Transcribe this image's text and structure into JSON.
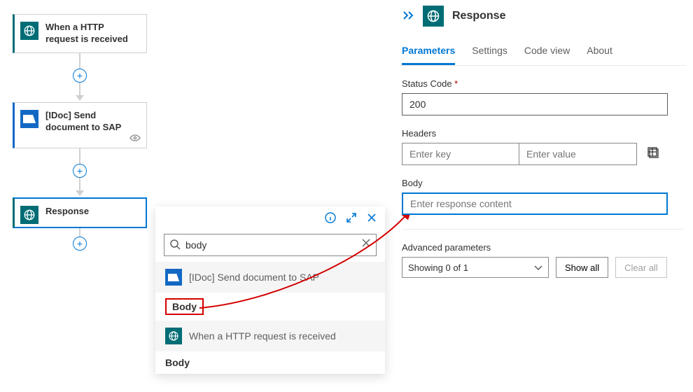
{
  "nodes": {
    "http": {
      "label": "When a HTTP request is received"
    },
    "sap": {
      "label": "[IDoc] Send document to SAP"
    },
    "resp": {
      "label": "Response"
    }
  },
  "popup": {
    "search_value": "body",
    "group1": "[IDoc] Send document to SAP",
    "item1": "Body",
    "group2": "When a HTTP request is received",
    "item2": "Body"
  },
  "panel": {
    "title": "Response",
    "tabs": {
      "parameters": "Parameters",
      "settings": "Settings",
      "code": "Code view",
      "about": "About"
    },
    "status_label": "Status Code",
    "status_value": "200",
    "headers_label": "Headers",
    "headers_key_ph": "Enter key",
    "headers_val_ph": "Enter value",
    "body_label": "Body",
    "body_ph": "Enter response content",
    "adv_label": "Advanced parameters",
    "adv_select": "Showing 0 of 1",
    "show_all": "Show all",
    "clear_all": "Clear all"
  }
}
